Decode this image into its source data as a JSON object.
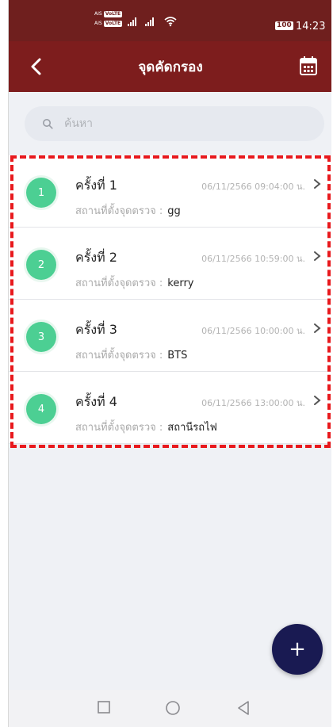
{
  "status_bar": {
    "carrier_1": "AIS",
    "carrier_2": "AIS",
    "net_badge_1": "VoLTE",
    "net_badge_2": "VoLTE",
    "battery": "100",
    "time": "14:23"
  },
  "header": {
    "title": "จุดคัดกรอง",
    "back_icon": "chevron-left-icon",
    "calendar_icon": "calendar-icon"
  },
  "search": {
    "placeholder": "ค้นหา",
    "icon": "search-icon"
  },
  "list": {
    "location_label": "สถานที่ตั้งจุดตรวจ :",
    "items": [
      {
        "number": "1",
        "title": "ครั้งที่ 1",
        "datetime": "06/11/2566 09:04:00 น.",
        "location": "gg"
      },
      {
        "number": "2",
        "title": "ครั้งที่ 2",
        "datetime": "06/11/2566 10:59:00 น.",
        "location": "kerry"
      },
      {
        "number": "3",
        "title": "ครั้งที่ 3",
        "datetime": "06/11/2566 10:00:00 น.",
        "location": "BTS"
      },
      {
        "number": "4",
        "title": "ครั้งที่ 4",
        "datetime": "06/11/2566 13:00:00 น.",
        "location": "สถานีรถไฟ"
      }
    ]
  },
  "fab": {
    "label": "+"
  },
  "colors": {
    "status_bar": "#6f1f1e",
    "header": "#7d1d1d",
    "badge_green": "#4ccf93",
    "fab": "#191a52",
    "highlight": "#e8191d"
  }
}
